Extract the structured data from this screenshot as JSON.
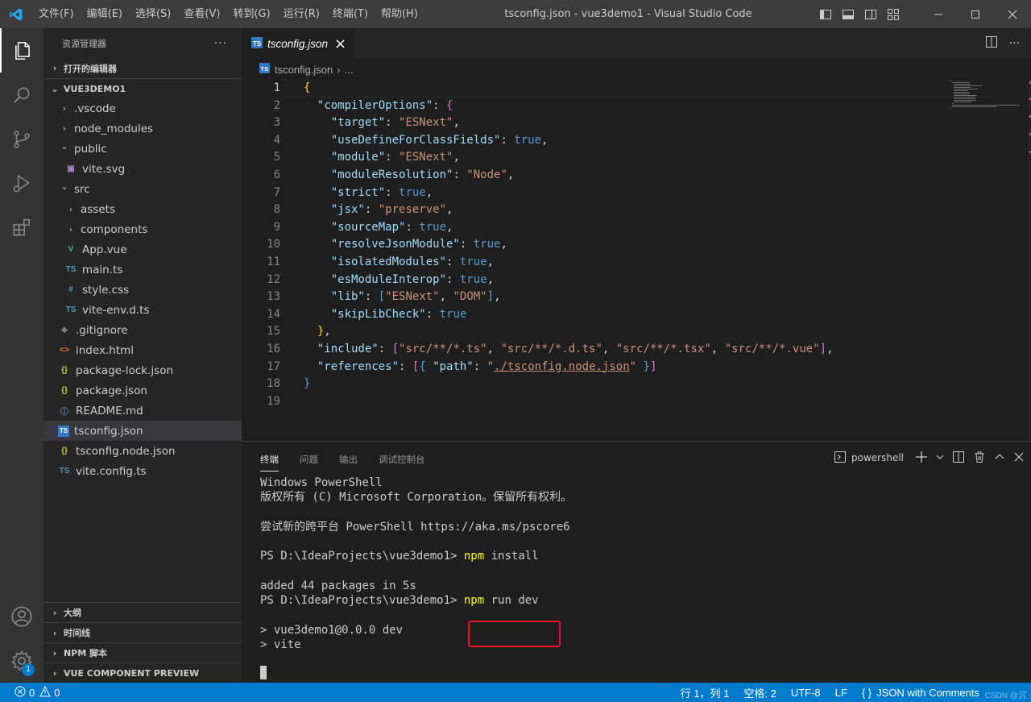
{
  "titlebar": {
    "menu": [
      "文件(F)",
      "编辑(E)",
      "选择(S)",
      "查看(V)",
      "转到(G)",
      "运行(R)",
      "终端(T)",
      "帮助(H)"
    ],
    "window_title": "tsconfig.json - vue3demo1 - Visual Studio Code"
  },
  "activitybar": {
    "items": [
      "explorer-icon",
      "search-icon",
      "source-control-icon",
      "run-debug-icon",
      "extensions-icon"
    ],
    "accounts_icon": "account-icon",
    "manage_icon": "gear-icon",
    "manage_badge": "1"
  },
  "sidebar": {
    "title": "资源管理器",
    "more": "···",
    "open_editors": "打开的编辑器",
    "project": "VUE3DEMO1",
    "tree": [
      {
        "label": ".vscode",
        "type": "folder",
        "state": "collapsed",
        "depth": 1
      },
      {
        "label": "node_modules",
        "type": "folder",
        "state": "collapsed",
        "depth": 1
      },
      {
        "label": "public",
        "type": "folder",
        "state": "expanded",
        "depth": 1
      },
      {
        "label": "vite.svg",
        "type": "svg",
        "depth": 2
      },
      {
        "label": "src",
        "type": "folder",
        "state": "expanded",
        "depth": 1
      },
      {
        "label": "assets",
        "type": "folder",
        "state": "collapsed",
        "depth": 2
      },
      {
        "label": "components",
        "type": "folder",
        "state": "collapsed",
        "depth": 2
      },
      {
        "label": "App.vue",
        "type": "vue",
        "depth": 2
      },
      {
        "label": "main.ts",
        "type": "ts",
        "depth": 2
      },
      {
        "label": "style.css",
        "type": "css",
        "depth": 2
      },
      {
        "label": "vite-env.d.ts",
        "type": "ts",
        "depth": 2
      },
      {
        "label": ".gitignore",
        "type": "git",
        "depth": 1
      },
      {
        "label": "index.html",
        "type": "html",
        "depth": 1
      },
      {
        "label": "package-lock.json",
        "type": "json",
        "depth": 1
      },
      {
        "label": "package.json",
        "type": "json",
        "depth": 1
      },
      {
        "label": "README.md",
        "type": "info",
        "depth": 1
      },
      {
        "label": "tsconfig.json",
        "type": "tsconfig",
        "depth": 1,
        "selected": true
      },
      {
        "label": "tsconfig.node.json",
        "type": "json",
        "depth": 1
      },
      {
        "label": "vite.config.ts",
        "type": "ts",
        "depth": 1
      }
    ],
    "bottom_sections": [
      "大纲",
      "时间线",
      "NPM 脚本",
      "VUE COMPONENT PREVIEW"
    ]
  },
  "editor": {
    "tab_label": "tsconfig.json",
    "tab_close": "×",
    "breadcrumb_file": "tsconfig.json",
    "breadcrumb_sep": "›",
    "breadcrumb_more": "...",
    "active_line": 1,
    "lines": [
      "{",
      "  \"compilerOptions\": {",
      "    \"target\": \"ESNext\",",
      "    \"useDefineForClassFields\": true,",
      "    \"module\": \"ESNext\",",
      "    \"moduleResolution\": \"Node\",",
      "    \"strict\": true,",
      "    \"jsx\": \"preserve\",",
      "    \"sourceMap\": true,",
      "    \"resolveJsonModule\": true,",
      "    \"isolatedModules\": true,",
      "    \"esModuleInterop\": true,",
      "    \"lib\": [\"ESNext\", \"DOM\"],",
      "    \"skipLibCheck\": true",
      "  },",
      "  \"include\": [\"src/**/*.ts\", \"src/**/*.d.ts\", \"src/**/*.tsx\", \"src/**/*.vue\"],",
      "  \"references\": [{ \"path\": \"./tsconfig.node.json\" }]",
      "}",
      ""
    ]
  },
  "panel": {
    "tabs": [
      "终端",
      "问题",
      "输出",
      "调试控制台"
    ],
    "active_tab": "终端",
    "shell_label": "powershell",
    "terminal_lines": [
      {
        "text": "Windows PowerShell"
      },
      {
        "text": "版权所有 (C) Microsoft Corporation。保留所有权利。"
      },
      {
        "text": ""
      },
      {
        "text": "尝试新的跨平台 PowerShell https://aka.ms/pscore6"
      },
      {
        "text": ""
      },
      {
        "prompt": "PS D:\\IdeaProjects\\vue3demo1> ",
        "cmd": "npm",
        "rest": " install"
      },
      {
        "text": ""
      },
      {
        "text": "added 44 packages in 5s"
      },
      {
        "prompt": "PS D:\\IdeaProjects\\vue3demo1> ",
        "cmd": "npm",
        "rest": " run dev"
      },
      {
        "text": ""
      },
      {
        "text": "> vue3demo1@0.0.0 dev"
      },
      {
        "text": "> vite"
      }
    ]
  },
  "statusbar": {
    "errors": "0",
    "warnings": "0",
    "position": "行 1，列 1",
    "spaces": "空格: 2",
    "encoding": "UTF-8",
    "eol": "LF",
    "language": "JSON with Comments",
    "watermark": "CSDN @沉"
  },
  "colors": {
    "accent": "#007acc",
    "highlight_box": "#e81123",
    "terminal_command": "#ffff00"
  }
}
